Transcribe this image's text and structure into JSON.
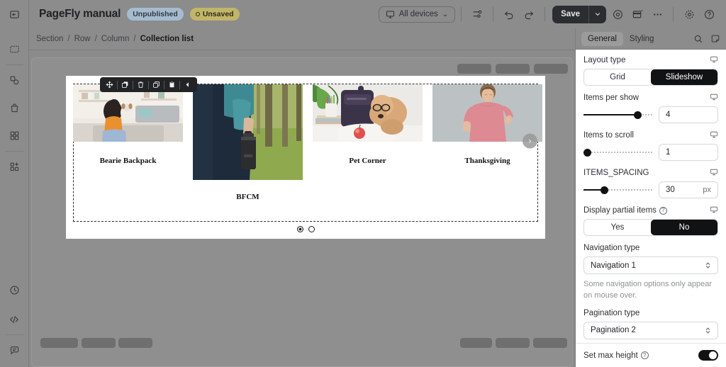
{
  "topbar": {
    "collapse_icon": "panel-collapse-icon",
    "title": "PageFly manual",
    "badges": [
      {
        "label": "Unpublished",
        "kind": "unpublished"
      },
      {
        "label": "Unsaved",
        "kind": "unsaved"
      }
    ],
    "devices_label": "All devices",
    "devices_caret": "⌄",
    "tools": [
      {
        "name": "settings-sliders-icon"
      },
      {
        "name": "undo-icon"
      },
      {
        "name": "redo-icon"
      }
    ],
    "save_label": "Save",
    "save_caret": "⌄",
    "right_icons": [
      {
        "name": "preview-eye-icon"
      },
      {
        "name": "layout-window-icon"
      },
      {
        "name": "more-options-icon"
      },
      {
        "name": "gear-icon"
      },
      {
        "name": "help-icon"
      }
    ]
  },
  "rail": {
    "items": [
      {
        "name": "sidebar-item-sections",
        "icon": "section-frame-icon"
      },
      {
        "name": "sidebar-item-elements",
        "icon": "elements-shapes-icon"
      },
      {
        "name": "sidebar-item-shopify",
        "icon": "shopify-bag-icon"
      },
      {
        "name": "sidebar-item-library",
        "icon": "grid-blocks-icon"
      },
      {
        "name": "sidebar-item-add-block",
        "icon": "add-block-icon"
      }
    ],
    "bottom_items": [
      {
        "name": "sidebar-item-history",
        "icon": "clock-history-icon"
      },
      {
        "name": "sidebar-item-code",
        "icon": "code-brackets-icon"
      },
      {
        "name": "sidebar-item-chat",
        "icon": "chat-bubble-icon"
      }
    ]
  },
  "breadcrumb": {
    "items": [
      "Section",
      "Row",
      "Column",
      "Collection list"
    ],
    "separator": "/"
  },
  "element_toolbar": {
    "buttons": [
      {
        "name": "move-handle",
        "icon": "move-arrows-icon"
      },
      {
        "name": "duplicate-button",
        "icon": "duplicate-icon"
      },
      {
        "name": "delete-button",
        "icon": "trash-icon"
      },
      {
        "name": "copy-button",
        "icon": "copy-icon"
      },
      {
        "name": "paste-button",
        "icon": "paste-clipboard-icon"
      },
      {
        "name": "collapse-toolbar-button",
        "icon": "chevron-left-icon"
      }
    ]
  },
  "slideshow": {
    "slides": [
      {
        "title": "Bearie Backpack",
        "image": "woman-holding-dog-in-living-room"
      },
      {
        "title": "BFCM",
        "image": "person-carrying-black-water-bottle-outdoors"
      },
      {
        "title": "Pet Corner",
        "image": "poodle-with-glasses-beside-backpack-and-books"
      },
      {
        "title": "Thanksgiving",
        "image": "man-in-pink-tshirt-on-gray-background"
      }
    ],
    "next_arrow_glyph": "›",
    "pagination": {
      "count": 2,
      "active_index": 0
    }
  },
  "right_panel": {
    "tabs": [
      {
        "label": "General",
        "active": true
      },
      {
        "label": "Styling",
        "active": false
      }
    ],
    "tab_icons": [
      {
        "name": "search-icon"
      },
      {
        "name": "note-icon"
      }
    ],
    "fields": {
      "layout_type": {
        "label": "Layout type",
        "options": [
          "Grid",
          "Slideshow"
        ],
        "selected": "Slideshow",
        "responsive_icon": "desktop-icon"
      },
      "items_per_show": {
        "label": "Items per show",
        "value": "4",
        "slider_percent": 78,
        "responsive_icon": "desktop-icon"
      },
      "items_to_scroll": {
        "label": "Items to scroll",
        "value": "1",
        "slider_percent": 0,
        "responsive_icon": "desktop-icon"
      },
      "items_spacing": {
        "label": "ITEMS_SPACING",
        "value": "30",
        "unit": "px",
        "slider_percent": 30,
        "responsive_icon": "desktop-icon"
      },
      "display_partial_items": {
        "label": "Display partial items",
        "help": "?",
        "options": [
          "Yes",
          "No"
        ],
        "selected": "No",
        "responsive_icon": "desktop-icon"
      },
      "navigation_type": {
        "label": "Navigation type",
        "value": "Navigation 1",
        "helper": "Some navigation options only appear on mouse over."
      },
      "pagination_type": {
        "label": "Pagination type",
        "value": "Pagination 2"
      },
      "set_max_height": {
        "label": "Set max height",
        "help": "?",
        "enabled": true
      }
    }
  },
  "colors": {
    "chrome_gray": "#8c8c8c",
    "dark_button": "#2b2d31",
    "accent_badge_unpublished": "#a5bcd0",
    "accent_badge_unsaved": "#c1b568",
    "panel_white": "#ffffff"
  }
}
